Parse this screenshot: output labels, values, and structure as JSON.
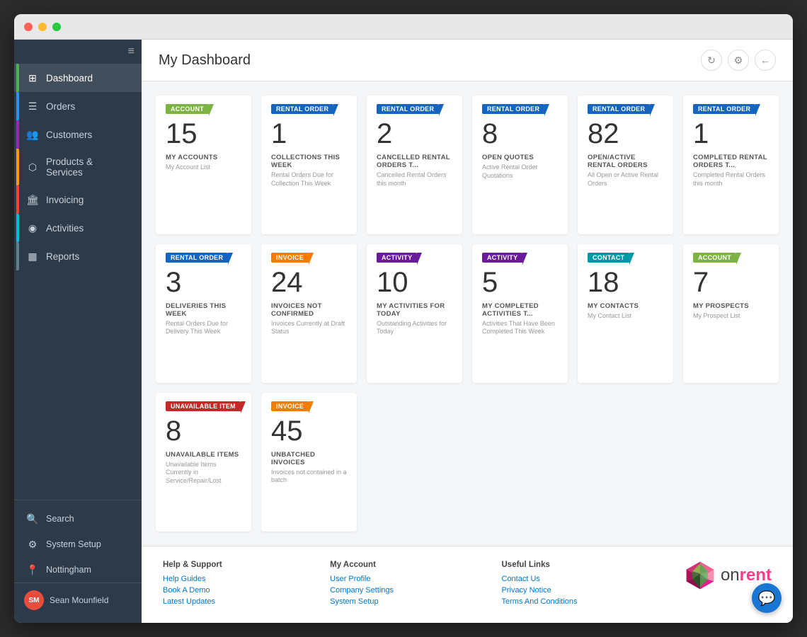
{
  "window": {
    "title": "My Dashboard"
  },
  "sidebar": {
    "collapse_icon": "≡",
    "items": [
      {
        "id": "dashboard",
        "label": "Dashboard",
        "icon": "⊞",
        "color": "#4caf50",
        "active": true
      },
      {
        "id": "orders",
        "label": "Orders",
        "icon": "☰",
        "color": "#2196f3",
        "active": false
      },
      {
        "id": "customers",
        "label": "Customers",
        "icon": "👥",
        "color": "#9c27b0",
        "active": false
      },
      {
        "id": "products",
        "label": "Products & Services",
        "icon": "⬡",
        "color": "#ff9800",
        "active": false
      },
      {
        "id": "invoicing",
        "label": "Invoicing",
        "icon": "🏛",
        "color": "#f44336",
        "active": false
      },
      {
        "id": "activities",
        "label": "Activities",
        "icon": "◉",
        "color": "#00bcd4",
        "active": false
      },
      {
        "id": "reports",
        "label": "Reports",
        "icon": "▦",
        "color": "#607d8b",
        "active": false
      }
    ],
    "bottom_items": [
      {
        "id": "search",
        "label": "Search",
        "icon": "🔍"
      },
      {
        "id": "system-setup",
        "label": "System Setup",
        "icon": "⚙"
      },
      {
        "id": "location",
        "label": "Nottingham",
        "icon": "📍"
      }
    ],
    "user": {
      "initials": "SM",
      "name": "Sean Mounfield",
      "avatar_color": "#e74c3c"
    }
  },
  "header": {
    "title": "My Dashboard",
    "buttons": [
      "↻",
      "⚙",
      "←"
    ]
  },
  "cards": [
    {
      "badge": "Account",
      "badge_color": "green",
      "number": "15",
      "title": "MY ACCOUNTS",
      "subtitle": "My Account List"
    },
    {
      "badge": "Rental Order",
      "badge_color": "blue",
      "number": "1",
      "title": "COLLECTIONS THIS WEEK",
      "subtitle": "Rental Orders Due for Collection This Week"
    },
    {
      "badge": "Rental Order",
      "badge_color": "blue",
      "number": "2",
      "title": "CANCELLED RENTAL ORDERS T...",
      "subtitle": "Cancelled Rental Orders this month"
    },
    {
      "badge": "Rental Order",
      "badge_color": "blue",
      "number": "8",
      "title": "OPEN QUOTES",
      "subtitle": "Active Rental Order Quotations"
    },
    {
      "badge": "Rental Order",
      "badge_color": "blue",
      "number": "82",
      "title": "OPEN/ACTIVE RENTAL ORDERS",
      "subtitle": "All Open or Active Rental Orders"
    },
    {
      "badge": "Rental Order",
      "badge_color": "blue",
      "number": "1",
      "title": "COMPLETED RENTAL ORDERS T...",
      "subtitle": "Completed Rental Orders this month"
    },
    {
      "badge": "Rental Order",
      "badge_color": "blue",
      "number": "3",
      "title": "DELIVERIES THIS WEEK",
      "subtitle": "Rental Orders Due for Delivery This Week"
    },
    {
      "badge": "Invoice",
      "badge_color": "orange",
      "number": "24",
      "title": "INVOICES NOT CONFIRMED",
      "subtitle": "Invoices Currently at Draft Status"
    },
    {
      "badge": "Activity",
      "badge_color": "purple",
      "number": "10",
      "title": "MY ACTIVITIES FOR TODAY",
      "subtitle": "Outstanding Activities for Today"
    },
    {
      "badge": "Activity",
      "badge_color": "purple",
      "number": "5",
      "title": "MY COMPLETED ACTIVITIES T...",
      "subtitle": "Activities That Have Been Completed This Week"
    },
    {
      "badge": "Contact",
      "badge_color": "cyan",
      "number": "18",
      "title": "MY CONTACTS",
      "subtitle": "My Contact List"
    },
    {
      "badge": "Account",
      "badge_color": "green",
      "number": "7",
      "title": "MY PROSPECTS",
      "subtitle": "My Prospect List"
    },
    {
      "badge": "Unavailable Item",
      "badge_color": "red",
      "number": "8",
      "title": "UNAVAILABLE ITEMS",
      "subtitle": "Unavailable Items Currently in Service/Repair/Lost"
    },
    {
      "badge": "Invoice",
      "badge_color": "orange",
      "number": "45",
      "title": "UNBATCHED INVOICES",
      "subtitle": "Invoices not contained in a batch"
    }
  ],
  "footer": {
    "help": {
      "heading": "Help & Support",
      "links": [
        "Help Guides",
        "Book A Demo",
        "Latest Updates"
      ]
    },
    "account": {
      "heading": "My Account",
      "links": [
        "User Profile",
        "Company Settings",
        "System Setup"
      ]
    },
    "useful": {
      "heading": "Useful Links",
      "links": [
        "Contact Us",
        "Privacy Notice",
        "Terms And Conditions"
      ]
    },
    "logo_text": "onrent"
  }
}
